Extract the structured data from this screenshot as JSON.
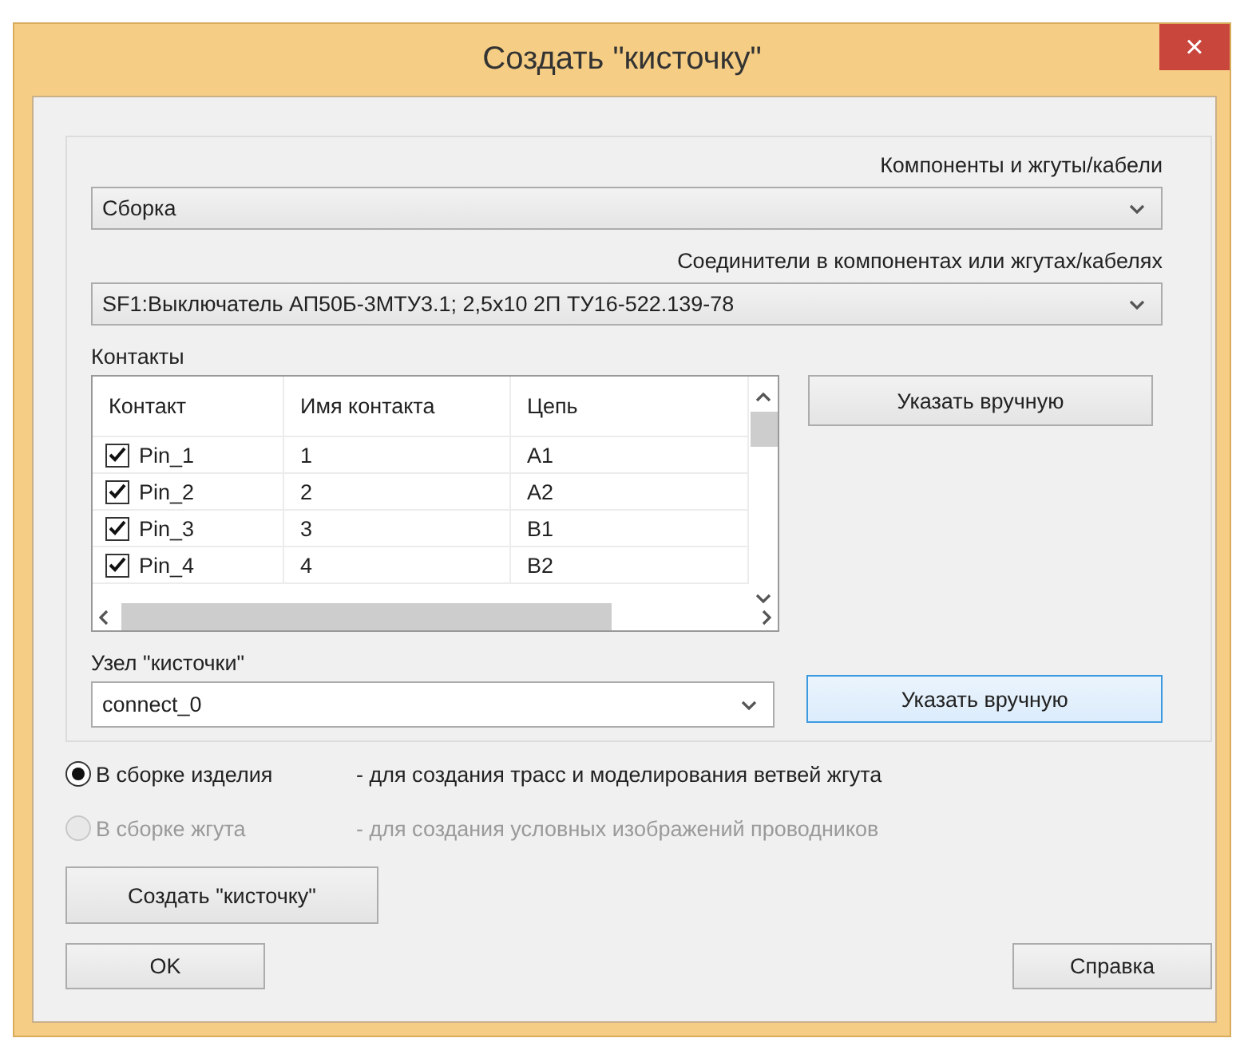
{
  "window": {
    "title": "Создать \"кисточку\"",
    "close": "×"
  },
  "components": {
    "label": "Компоненты и жгуты/кабели",
    "value": "Сборка"
  },
  "connectors": {
    "label": "Соединители в компонентах или жгутах/кабелях",
    "value": "SF1:Выключатель АП50Б-3МТУ3.1; 2,5x10 2П  ТУ16-522.139-78"
  },
  "contacts": {
    "label": "Контакты",
    "columns": [
      "Контакт",
      "Имя контакта",
      "Цепь"
    ],
    "rows": [
      {
        "checked": true,
        "contact": "Pin_1",
        "name": "1",
        "circuit": "A1"
      },
      {
        "checked": true,
        "contact": "Pin_2",
        "name": "2",
        "circuit": "A2"
      },
      {
        "checked": true,
        "contact": "Pin_3",
        "name": "3",
        "circuit": "B1"
      },
      {
        "checked": true,
        "contact": "Pin_4",
        "name": "4",
        "circuit": "B2"
      }
    ],
    "button": "Указать вручную"
  },
  "node": {
    "label": "Узел \"кисточки\"",
    "value": "connect_0",
    "button": "Указать вручную"
  },
  "radios": [
    {
      "label": "В сборке изделия",
      "description": "- для создания трасс и моделирования ветвей жгута",
      "selected": true,
      "disabled": false
    },
    {
      "label": "В сборке жгута",
      "description": "- для создания условных изображений проводников",
      "selected": false,
      "disabled": true
    }
  ],
  "create_button": "Создать \"кисточку\"",
  "ok_button": "OK",
  "help_button": "Справка"
}
